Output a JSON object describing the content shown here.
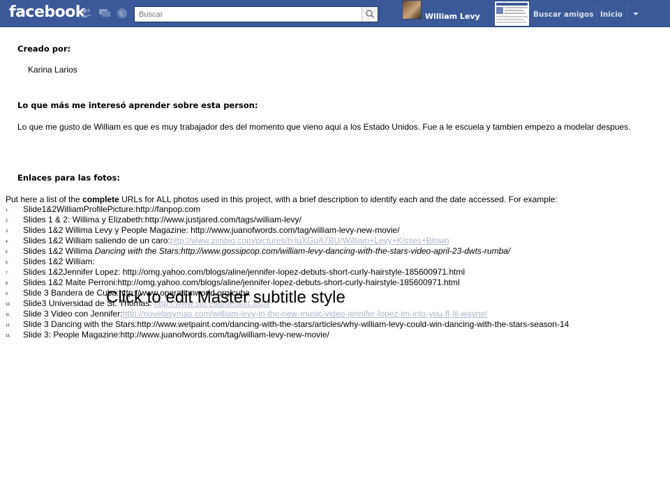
{
  "fb": {
    "logo": "facebook",
    "search_placeholder": "Buscar",
    "profile_name": "William Levy",
    "nav_find_friends": "Buscar amigos",
    "nav_home": "Inicio"
  },
  "content": {
    "created_by_heading": "Creado por:",
    "author": "Karina Larios",
    "interest_heading": "Lo que más me interesó aprender sobre esta person:",
    "interest_text": "Lo que me gusto de William es que es muy trabajador des del momento que vieno aqui a los Estado Unidos. Fue a le escuela y tambien empezo a modelar despues.",
    "links_heading": "Enlaces para las fotos:",
    "intro_before": "Put here  a list of the ",
    "intro_bold": "complete",
    "intro_after": " URLs  for ALL photos used in this project, with a brief description to identify each and the date accessed. For example:",
    "photos": [
      {
        "num": "1.",
        "text": "Slide1&2WilliamProfilePicture:http://fanpop.com",
        "link": ""
      },
      {
        "num": "2.",
        "text": "Slides 1 & 2: Willima y Elizabeth:http://www.justjared.com/tags/william-levy/",
        "link": ""
      },
      {
        "num": "3.",
        "text": "Slides 1&2 Willima Levy y People Magazine: http://www.juanofwords.com/tag/william-levy-new-movie/",
        "link": ""
      },
      {
        "num": "4.",
        "text": "Slides 1&2 William saliendo de un caro:",
        "link": "http://www.zimbio.com/pictures/h-luXGuA7BU/William+Levy+Kisses+Blown"
      },
      {
        "num": "5.",
        "text": "Slides 1&2 Willima ",
        "italic": "Dancing with the Stars:http://www.gossipcop.com/william-levy-dancing-with-the-stars-video-april-23-dwts-rumba/",
        "link": ""
      },
      {
        "num": "6.",
        "text": "Slides 1&2 William:",
        "link": ""
      },
      {
        "num": "7.",
        "text": "Slides 1&2Jennifer Lopez: http://omg.yahoo.com/blogs/aline/jennifer-lopez-debuts-short-curly-hairstyle-185600971.html",
        "link": ""
      },
      {
        "num": "8.",
        "text": "Slides 1&2 Maite Perroni:http://omg.yahoo.com/blogs/aline/jennifer-lopez-debuts-short-curly-hairstyle-185600971.html",
        "link": ""
      },
      {
        "num": "9.",
        "text": "Slide 3 Bandera de Cuba:http://www.operationworld.org/cuba",
        "link": ""
      },
      {
        "num": "10.",
        "text": "Slide3 Universidad de St. Thomas: ",
        "link": "http://www.stu.edu/default.aspx"
      },
      {
        "num": "11.",
        "text": "Slide 3 Video con Jennifer:",
        "link": "http://novelasymas.com/william-levy-in-the-new-music-video-jennifer-lopez-im-into-you-ft-lil-wayne/"
      },
      {
        "num": "12.",
        "text": "Slide 3 Dancing with the Stars:http://www.wetpaint.com/dancing-with-the-stars/articles/why-william-levy-could-win-dancing-with-the-stars-season-14",
        "link": ""
      },
      {
        "num": "13.",
        "text": "Slide 3: People Magazine:http://www.juanofwords.com/tag/william-levy-new-movie/",
        "link": ""
      }
    ],
    "overlay": "Click to edit Master subtitle style"
  }
}
